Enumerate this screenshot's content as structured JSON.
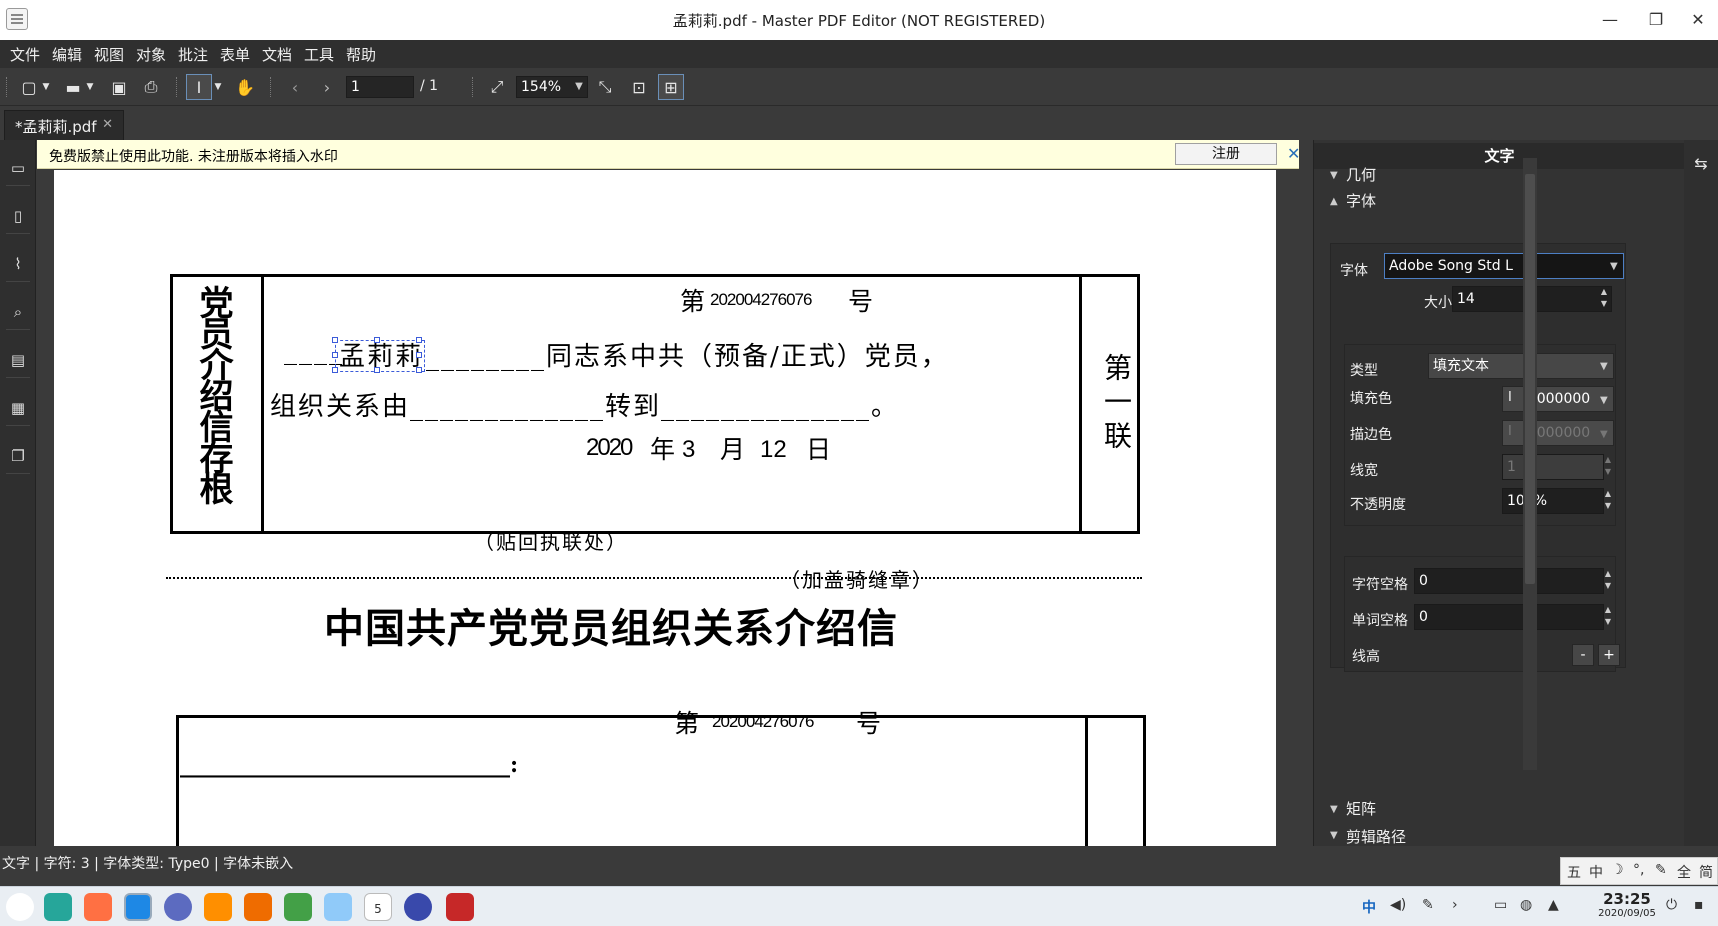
{
  "window": {
    "title": "孟莉莉.pdf - Master PDF Editor (NOT REGISTERED)",
    "minimize": "—",
    "maximize": "❐",
    "close": "✕"
  },
  "menu": [
    "文件",
    "编辑",
    "视图",
    "对象",
    "批注",
    "表单",
    "文档",
    "工具",
    "帮助"
  ],
  "toolbar": {
    "page_current": "1",
    "page_total": "/ 1",
    "zoom": "154%"
  },
  "tab": {
    "label": "*孟莉莉.pdf",
    "close": "✕"
  },
  "notice": {
    "message": "免费版禁止使用此功能. 未注册版本将插入水印",
    "register_button": "注册",
    "close": "✕"
  },
  "document": {
    "stub_title": "党员介绍信存根",
    "stub_lian": "第一联",
    "no_prefix": "第",
    "number": "202004276076",
    "no_suffix": "号",
    "name": "孟莉莉",
    "line1_rest": "________同志系中共（预备/正式）党员，",
    "line1_lead": "____",
    "line2": "组织关系由_____________转到______________。",
    "date_year": "2020",
    "date_year_label": "年",
    "date_month": "3",
    "date_month_label": "月",
    "date_day": "12",
    "date_day_label": "日",
    "paste_note": "（贴回执联处）",
    "seal_note": "（加盖骑缝章）",
    "letter_title": "中国共产党党员组织关系介绍信",
    "no2_prefix": "第",
    "number2": "202004276076",
    "no2_suffix": "号",
    "addressee_line": "______________________________:"
  },
  "right_panel": {
    "header": "文字",
    "geometry": "几何",
    "font_section": "字体",
    "font_label": "字体",
    "font_value": "Adobe Song Std L",
    "size_label": "大小",
    "size_value": "14",
    "type_label": "类型",
    "type_value": "填充文本",
    "fill_label": "填充色",
    "fill_value": "#000000",
    "stroke_label": "描边色",
    "stroke_value": "#000000",
    "linewidth_label": "线宽",
    "linewidth_value": "1",
    "opacity_label": "不透明度",
    "opacity_value": "100%",
    "char_spacing_label": "字符空格",
    "char_spacing_value": "0",
    "word_spacing_label": "单词空格",
    "word_spacing_value": "0",
    "line_height_label": "线高",
    "minus": "-",
    "plus": "+",
    "matrix": "矩阵",
    "clip_path": "剪辑路径"
  },
  "status": {
    "text": "文字 | 字符: 3 | 字体类型: Type0 | 字体未嵌入"
  },
  "ime": [
    "五",
    "中",
    "☽",
    "°,",
    "✎",
    "全",
    "简"
  ],
  "taskbar": {
    "ime_mode": "中",
    "time": "23:25",
    "date": "2020/09/05",
    "calendar_day": "5"
  },
  "colors": {
    "accent": "#4d7fc4",
    "selection": "#3b5bd9",
    "notice_bg": "#ffffde"
  }
}
